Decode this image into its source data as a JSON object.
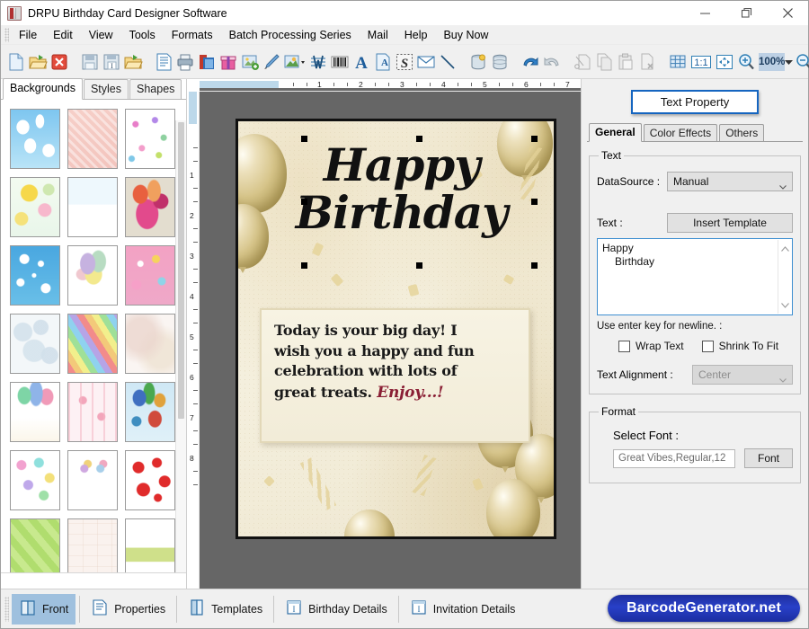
{
  "window": {
    "title": "DRPU Birthday Card Designer Software",
    "icon": "app-icon",
    "controls": [
      {
        "name": "minimize-button",
        "glyph": "minimize"
      },
      {
        "name": "maximize-button",
        "glyph": "restore"
      },
      {
        "name": "close-button",
        "glyph": "close"
      }
    ]
  },
  "menubar": {
    "items": [
      {
        "label": "File"
      },
      {
        "label": "Edit"
      },
      {
        "label": "View"
      },
      {
        "label": "Tools"
      },
      {
        "label": "Formats"
      },
      {
        "label": "Batch Processing Series"
      },
      {
        "label": "Mail"
      },
      {
        "label": "Help"
      },
      {
        "label": "Buy Now"
      }
    ]
  },
  "toolbar": {
    "zoom_value": "100%",
    "groups": [
      [
        "new-document-icon",
        "open-folder-icon",
        "close-document-icon"
      ],
      [
        "save-icon",
        "save-as-icon",
        "open-recent-icon"
      ],
      [
        "card-properties-icon",
        "print-icon",
        "background-icon",
        "gift-icon",
        "insert-image-icon",
        "pen-tool-icon",
        "picture-dropdown-icon",
        "watermark-icon",
        "barcode-icon",
        "text-icon",
        "text-box-icon",
        "signature-icon",
        "envelope-icon",
        "line-tool-icon"
      ],
      [
        "database-insert-icon",
        "database-icon"
      ],
      [
        "undo-icon",
        "redo-icon"
      ],
      [
        "cut-icon",
        "copy-icon",
        "paste-icon",
        "delete-icon"
      ],
      [
        "grid-icon",
        "actual-size-icon",
        "fit-to-window-icon",
        "zoom-in-icon",
        "zoom-combo",
        "zoom-out-icon"
      ]
    ]
  },
  "left_panel": {
    "tabs": [
      {
        "label": "Backgrounds",
        "active": true
      },
      {
        "label": "Styles",
        "active": false
      },
      {
        "label": "Shapes",
        "active": false
      }
    ],
    "thumbnails": [
      {
        "name": "background-clouds-blue"
      },
      {
        "name": "background-pink-texture"
      },
      {
        "name": "background-butterflies-flowers"
      },
      {
        "name": "background-yellow-daisies"
      },
      {
        "name": "background-winter-snowmen"
      },
      {
        "name": "background-balloons-beige"
      },
      {
        "name": "background-blue-stars"
      },
      {
        "name": "background-pastel-balloons-white"
      },
      {
        "name": "background-pink-party-balloons"
      },
      {
        "name": "background-white-bubbles"
      },
      {
        "name": "background-rainbow-stripes"
      },
      {
        "name": "background-soft-cream"
      },
      {
        "name": "background-happy-birthday-balloons"
      },
      {
        "name": "background-pink-hearts-stripes"
      },
      {
        "name": "background-sky-balloons"
      },
      {
        "name": "background-pastel-hearts"
      },
      {
        "name": "background-balloon-bouquets"
      },
      {
        "name": "background-red-hearts"
      },
      {
        "name": "background-green-diagonal-stripes"
      },
      {
        "name": "background-cream-cakes"
      },
      {
        "name": "background-confetti-garden"
      }
    ]
  },
  "canvas": {
    "h_ruler_labels": [
      "1",
      "2",
      "3",
      "4",
      "5",
      "6",
      "7"
    ],
    "v_ruler_labels": [
      "1",
      "2",
      "3",
      "4",
      "5",
      "6",
      "7",
      "8"
    ],
    "card": {
      "title_line1": "Happy",
      "title_line2": "Birthday",
      "message_lines": [
        "Today is your big day! I",
        "wish you a happy and fun",
        "celebration with lots of"
      ],
      "message_last_prefix": "great treats.",
      "message_last_script": "Enjoy...!"
    }
  },
  "right_panel": {
    "title": "Text Property",
    "tabs": [
      {
        "label": "General",
        "active": true
      },
      {
        "label": "Color Effects",
        "active": false
      },
      {
        "label": "Others",
        "active": false
      }
    ],
    "text_group": {
      "legend": "Text",
      "datasource_label": "DataSource :",
      "datasource_value": "Manual",
      "text_label": "Text :",
      "insert_template_button": "Insert Template",
      "textarea_line1": "Happy",
      "textarea_line2": "Birthday",
      "hint": "Use enter key for newline. :",
      "wrap_text_label": "Wrap Text",
      "shrink_to_fit_label": "Shrink To Fit",
      "alignment_label": "Text Alignment :",
      "alignment_value": "Center"
    },
    "format_group": {
      "legend": "Format",
      "select_font_label": "Select Font :",
      "font_value": "Great Vibes,Regular,12",
      "font_button": "Font"
    }
  },
  "statusbar": {
    "items": [
      {
        "label": "Front",
        "icon": "front-card-icon",
        "active": true
      },
      {
        "label": "Properties",
        "icon": "properties-icon",
        "active": false
      },
      {
        "label": "Templates",
        "icon": "templates-icon",
        "active": false
      },
      {
        "label": "Birthday Details",
        "icon": "birthday-details-icon",
        "active": false
      },
      {
        "label": "Invitation Details",
        "icon": "invitation-details-icon",
        "active": false
      }
    ],
    "brand": "BarcodeGenerator.net"
  },
  "colors": {
    "accent_blue": "#1565c0",
    "brand_blue": "#2840c8",
    "canvas_gray": "#666666",
    "active_tab_bg": "#9fc0de"
  }
}
